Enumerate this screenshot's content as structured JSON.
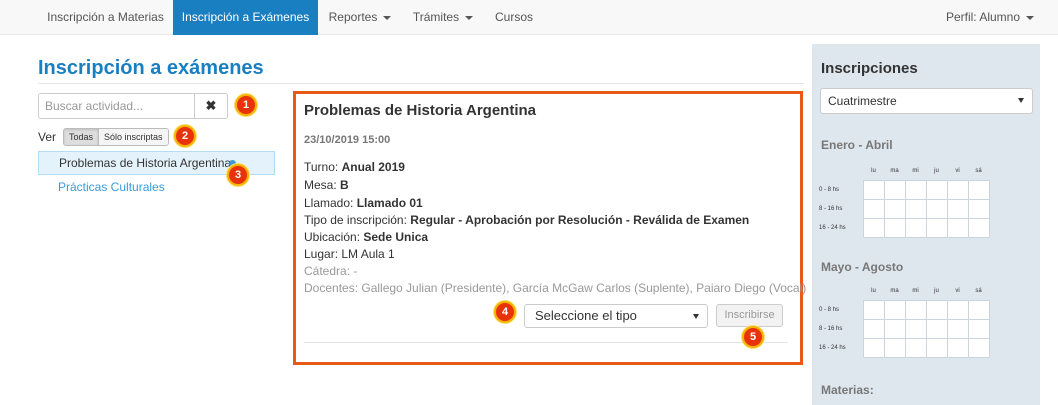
{
  "nav": {
    "items": [
      {
        "label": "Inscripción a Materias"
      },
      {
        "label": "Inscripción a Exámenes"
      },
      {
        "label": "Reportes"
      },
      {
        "label": "Trámites"
      },
      {
        "label": "Cursos"
      }
    ],
    "active_index": 1,
    "profile_label": "Perfil: Alumno"
  },
  "page": {
    "title": "Inscripción a exámenes"
  },
  "search": {
    "placeholder": "Buscar actividad...",
    "clear_symbol": "✖"
  },
  "filter": {
    "label": "Ver",
    "options": [
      "Todas",
      "Sólo inscriptas"
    ],
    "selected": "Todas"
  },
  "activities": [
    {
      "name": "Problemas de Historia Argentina",
      "selected": true
    },
    {
      "name": "Prácticas Culturales",
      "selected": false
    }
  ],
  "badges": [
    "1",
    "2",
    "3",
    "4",
    "5"
  ],
  "detail": {
    "title": "Problemas de Historia Argentina",
    "date": "23/10/2019 15:00",
    "fields": [
      {
        "label": "Turno: ",
        "value": "Anual 2019"
      },
      {
        "label": "Mesa: ",
        "value": "B"
      },
      {
        "label": "Llamado: ",
        "value": "Llamado 01"
      },
      {
        "label": "Tipo de inscripción: ",
        "value": "Regular - Aprobación por Resolución - Reválida de Examen"
      },
      {
        "label": "Ubicación: ",
        "value": "Sede Unica"
      },
      {
        "label": "Lugar: ",
        "value": "LM Aula 1"
      }
    ],
    "catedra": "Cátedra: -",
    "docentes": "Docentes: Gallego Julian (Presidente), García McGaw Carlos (Suplente), Paiaro Diego (Vocal)",
    "tipo_select": "Seleccione el tipo",
    "submit_label": "Inscribirse"
  },
  "sidebar": {
    "title": "Inscripciones",
    "period_select": "Cuatrimestre",
    "sections": [
      {
        "title": "Enero - Abril"
      },
      {
        "title": "Mayo - Agosto"
      }
    ],
    "day_headers": [
      "lu",
      "ma",
      "mi",
      "ju",
      "vi",
      "sá"
    ],
    "time_slots": [
      "0 - 8 hs",
      "8 - 16 hs",
      "16 - 24 hs"
    ],
    "materias_label": "Materias:"
  },
  "colors": {
    "accent": "#1a7fc1",
    "highlight_border": "#e85a1a",
    "badge": "#e8320a",
    "sidebar_bg": "#dfe7ee"
  }
}
